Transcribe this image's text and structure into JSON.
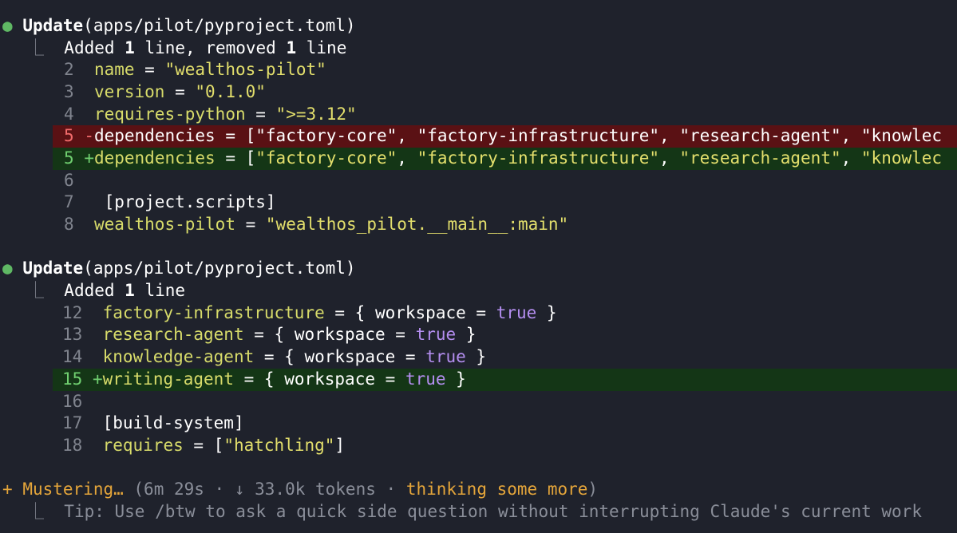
{
  "block1": {
    "bullet": "●",
    "verb": "Update",
    "path": "(apps/pilot/pyproject.toml)",
    "summary_pre": "Added ",
    "summary_n1": "1",
    "summary_mid": " line, removed ",
    "summary_n2": "1",
    "summary_post": " line",
    "lines": [
      {
        "n": "2",
        "key": "name",
        "eq": " = ",
        "val": "\"wealthos-pilot\""
      },
      {
        "n": "3",
        "key": "version",
        "eq": " = ",
        "val": "\"0.1.0\""
      },
      {
        "n": "4",
        "key": "requires-python",
        "eq": " = ",
        "val": "\">=3.12\""
      }
    ],
    "del_n": "5",
    "del_mark": "-",
    "add_n": "5",
    "add_mark": "+",
    "dep_key": "dependencies",
    "dep_eq": " = [",
    "dep_1": "\"factory-core\"",
    "dep_2": "\"factory-infrastructure\"",
    "dep_3": "\"research-agent\"",
    "dep_4": "\"knowlec",
    "sep": ", ",
    "l6_n": "6",
    "l7_n": "7",
    "l7_text": "[project.scripts]",
    "l8_n": "8",
    "l8_key": "wealthos-pilot",
    "l8_eq": " = ",
    "l8_val": "\"wealthos_pilot.__main__:main\""
  },
  "block2": {
    "bullet": "●",
    "verb": "Update",
    "path": "(apps/pilot/pyproject.toml)",
    "summary_pre": "Added ",
    "summary_n1": "1",
    "summary_post": " line",
    "l12_n": "12",
    "l12_key": "factory-infrastructure",
    "l13_n": "13",
    "l13_key": "research-agent",
    "l14_n": "14",
    "l14_key": "knowledge-agent",
    "l15_n": "15",
    "l15_mark": "+",
    "l15_key": "writing-agent",
    "ws_open": " = { ",
    "ws_key": "workspace",
    "ws_eq": " = ",
    "ws_val": "true",
    "ws_close": " }",
    "l16_n": "16",
    "l17_n": "17",
    "l17_text": "[build-system]",
    "l18_n": "18",
    "l18_key": "requires",
    "l18_eq": " = [",
    "l18_val": "\"hatchling\"",
    "l18_close": "]"
  },
  "status": {
    "spinner": "+",
    "word": "Mustering…",
    "open": " (",
    "elapsed": "6m 29s",
    "dot1": " · ",
    "arrow": "↓",
    "tokens": " 33.0k tokens",
    "dot2": " · ",
    "thinking": "thinking some more",
    "close": ")",
    "tip": "Tip: Use /btw to ask a quick side question without interrupting Claude's current work"
  },
  "tree_corner": "⎿"
}
